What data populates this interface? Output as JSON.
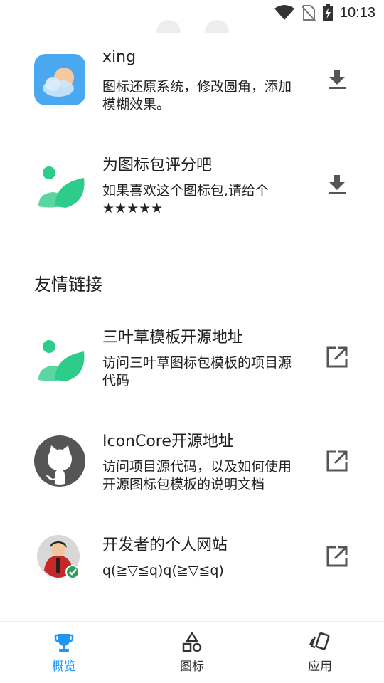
{
  "status_bar": {
    "time": "10:13"
  },
  "apps": [
    {
      "title": "xing",
      "desc": "图标还原系统，修改圆角，添加模糊效果。",
      "action_icon": "download-icon"
    },
    {
      "title": "为图标包评分吧",
      "desc": "如果喜欢这个图标包,请给个★★★★★",
      "action_icon": "download-icon"
    }
  ],
  "section": {
    "title": "友情链接"
  },
  "links": [
    {
      "title": "三叶草模板开源地址",
      "desc": "访问三叶草图标包模板的项目源代码",
      "action_icon": "open-in-new-icon"
    },
    {
      "title": "IconCore开源地址",
      "desc": "访问项目源代码，以及如何使用开源图标包模板的说明文档",
      "action_icon": "open-in-new-icon"
    },
    {
      "title": "开发者的个人网站",
      "desc": "q(≧▽≦q)q(≧▽≦q)",
      "action_icon": "open-in-new-icon"
    }
  ],
  "bottom_nav": [
    {
      "label": "概览",
      "icon": "trophy-icon",
      "active": true
    },
    {
      "label": "图标",
      "icon": "shapes-icon",
      "active": false
    },
    {
      "label": "应用",
      "icon": "cards-icon",
      "active": false
    }
  ],
  "colors": {
    "accent": "#2196f3",
    "leaf_green": "#2ecc8a",
    "leaf_light": "#5cd6a0"
  }
}
